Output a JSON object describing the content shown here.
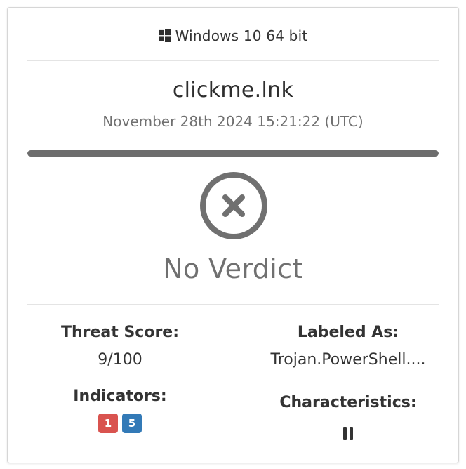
{
  "report": {
    "os": {
      "icon": "windows-icon",
      "label": "Windows 10 64 bit"
    },
    "filename": "clickme.lnk",
    "timestamp": "November 28th 2024 15:21:22 (UTC)",
    "progress_fraction": 1.0,
    "verdict": {
      "icon": "circle-x-icon",
      "label": "No Verdict"
    },
    "threat_score": {
      "title": "Threat Score:",
      "value": "9/100"
    },
    "labeled_as": {
      "title": "Labeled As:",
      "value": "Trojan.PowerShell...."
    },
    "indicators": {
      "title": "Indicators:",
      "malicious_count": "1",
      "suspicious_count": "5"
    },
    "characteristics": {
      "title": "Characteristics:",
      "icon": "pause-icon"
    },
    "colors": {
      "malicious": "#d9534f",
      "suspicious": "#337ab7",
      "progress": "#6d6d6d",
      "verdict": "#707070"
    }
  }
}
